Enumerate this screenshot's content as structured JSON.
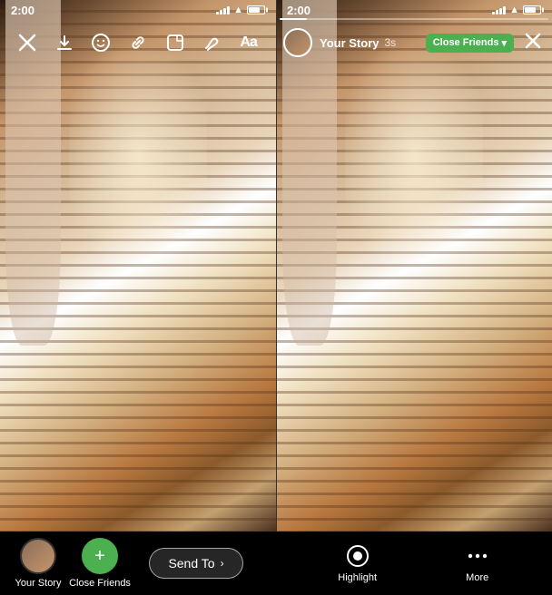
{
  "status": {
    "time_left": "2:00",
    "time_right": "2:00",
    "signal_label": "signal",
    "wifi_label": "wifi",
    "battery_label": "battery"
  },
  "toolbar": {
    "close_label": "×",
    "download_label": "↓",
    "emoji_label": "☺",
    "link_label": "🔗",
    "sticker_label": "◻",
    "draw_label": "✏",
    "text_label": "Aa"
  },
  "story_header": {
    "username": "Your Story",
    "time": "3s",
    "close_friends_label": "Close Friends",
    "chevron_label": "▾"
  },
  "bottom": {
    "your_story_label": "Your Story",
    "close_friends_label": "Close Friends",
    "send_to_label": "Send To",
    "highlight_label": "Highlight",
    "more_label": "More"
  }
}
